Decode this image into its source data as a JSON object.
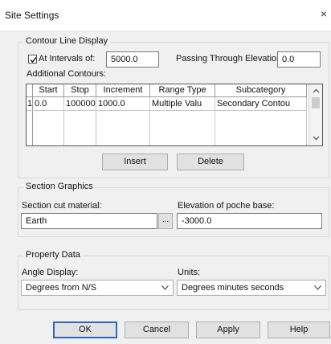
{
  "window": {
    "title": "Site Settings",
    "close_glyph": "×"
  },
  "contour": {
    "group_title": "Contour Line Display",
    "at_intervals_label": "At Intervals of:",
    "at_intervals_checked": true,
    "interval_value": "5000.0",
    "passing_label": "Passing Through Elevation:",
    "passing_value": "0.0",
    "additional_label": "Additional Contours:",
    "columns": [
      "Start",
      "Stop",
      "Increment",
      "Range Type",
      "Subcategory"
    ],
    "rows": [
      {
        "num": "1",
        "start": "0.0",
        "stop": "100000",
        "increment": "1000.0",
        "range_type": "Multiple Valu",
        "subcategory": "Secondary Contou"
      }
    ],
    "insert_label": "Insert",
    "delete_label": "Delete"
  },
  "section": {
    "group_title": "Section Graphics",
    "material_label": "Section cut material:",
    "material_value": "Earth",
    "browse_label": "...",
    "poche_label": "Elevation of poche base:",
    "poche_value": "-3000.0"
  },
  "property": {
    "group_title": "Property Data",
    "angle_label": "Angle Display:",
    "angle_value": "Degrees from N/S",
    "units_label": "Units:",
    "units_value": "Degrees minutes seconds"
  },
  "footer": {
    "ok": "OK",
    "cancel": "Cancel",
    "apply": "Apply",
    "help": "Help"
  },
  "colors": {
    "dialog_bg": "#f0f0f0",
    "default_button_border": "#2b67c7"
  }
}
